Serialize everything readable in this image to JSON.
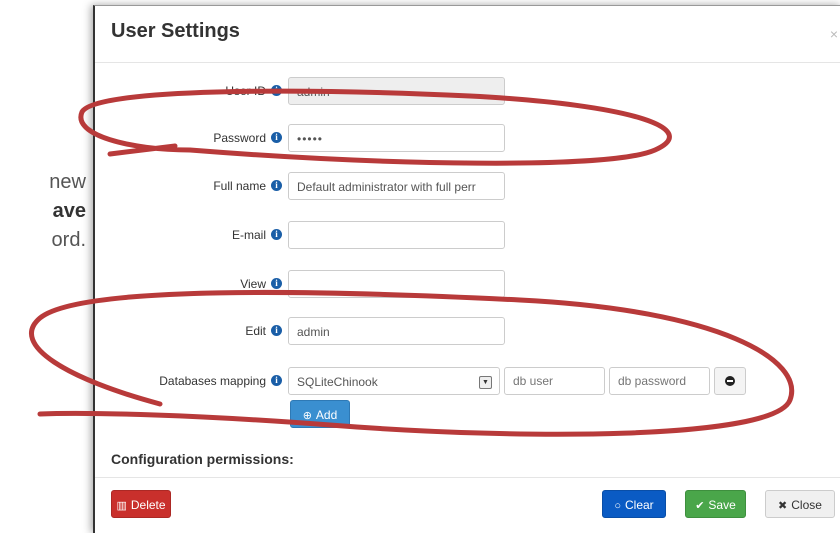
{
  "background_text": {
    "line1": "new",
    "line2": "ave",
    "line3": "ord."
  },
  "modal": {
    "title": "User Settings",
    "close_x": "×",
    "fields": {
      "user_id": {
        "label": "User ID",
        "value": "admin"
      },
      "password": {
        "label": "Password",
        "value": "•••••"
      },
      "full_name": {
        "label": "Full name",
        "value": "Default administrator with full perr"
      },
      "email": {
        "label": "E-mail",
        "value": ""
      },
      "view": {
        "label": "View",
        "value": ""
      },
      "edit": {
        "label": "Edit",
        "value": "admin"
      }
    },
    "db_mapping": {
      "label": "Databases mapping",
      "selected": "SQLiteChinook",
      "db_user_placeholder": "db user",
      "db_password_placeholder": "db password",
      "add_label": "Add"
    },
    "section_title": "Configuration permissions:",
    "footer": {
      "delete_label": "Delete",
      "clear_label": "Clear",
      "save_label": "Save",
      "close_label": "Close"
    }
  },
  "colors": {
    "annotation": "#b83a3a",
    "info_icon": "#1a5ea7"
  }
}
